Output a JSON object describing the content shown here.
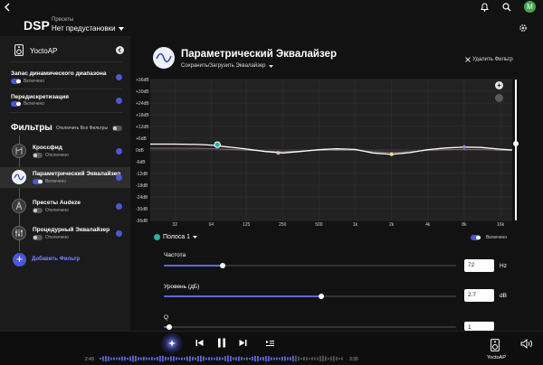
{
  "header": {
    "title": "DSP",
    "preset_caption": "Пресеты",
    "preset_value": "Нет предустановки",
    "avatar_letter": "M"
  },
  "sidebar": {
    "device_name": "YoctoAP",
    "settings": [
      {
        "label": "Запас динамического диапазона",
        "state": "Включено",
        "on": true
      },
      {
        "label": "Передискретизация",
        "state": "Включено",
        "on": true
      }
    ],
    "filters_title": "Фильтры",
    "disable_all_label": "Отключить Все Фильтры",
    "filters": [
      {
        "name": "Кроссфид",
        "state": "Отключено",
        "on": false,
        "selected": false
      },
      {
        "name": "Параметрический Эквалайзер",
        "state": "Включено",
        "on": true,
        "selected": true
      },
      {
        "name": "Пресеты Audeze",
        "state": "Отключено",
        "on": false,
        "selected": false
      },
      {
        "name": "Процедурный Эквалайзер",
        "state": "Отключено",
        "on": false,
        "selected": false
      }
    ],
    "add_filter_label": "Добавить Фильтр"
  },
  "main": {
    "title": "Параметрический Эквалайзер",
    "save_load_label": "Сохранить/Загрузить Эквалайзер",
    "delete_filter_label": "Удалить Фильтр"
  },
  "chart_data": {
    "type": "line",
    "x_scale": "log",
    "y_ticks": [
      "+36dB",
      "+30dB",
      "+24dB",
      "+18dB",
      "+12dB",
      "+6dB",
      "0dB",
      "-6dB",
      "-12dB",
      "-18dB",
      "-24dB",
      "-30dB",
      "-36dB"
    ],
    "x_ticks": [
      "32",
      "64",
      "125",
      "250",
      "500",
      "1k",
      "2k",
      "4k",
      "8k",
      "16k"
    ],
    "ylim": [
      -36,
      36
    ],
    "grid": true,
    "curve": {
      "x": [
        20,
        32,
        50,
        64,
        90,
        125,
        180,
        250,
        350,
        500,
        700,
        1000,
        1400,
        2000,
        2800,
        4000,
        5600,
        8000,
        11000,
        16000,
        20000
      ],
      "y": [
        3,
        3,
        2.8,
        2.5,
        1.5,
        0.5,
        -0.8,
        -1.5,
        -0.8,
        0.2,
        0.6,
        0.3,
        -1.5,
        -2.2,
        -1.4,
        0.2,
        1,
        1.5,
        1.3,
        0.4,
        0
      ]
    },
    "bands": [
      {
        "freq": 72,
        "gain": 2.7,
        "color": "#26b3a3"
      },
      {
        "freq": 230,
        "gain": -1.5,
        "color": "#e2b7d8"
      },
      {
        "freq": 2000,
        "gain": -2.2,
        "color": "#e7e86a"
      },
      {
        "freq": 8000,
        "gain": 1.5,
        "color": "#9a85d8"
      }
    ],
    "vertical_slider_value": 0
  },
  "band": {
    "label": "Полоса 1",
    "enabled_label": "Включено",
    "frequency": {
      "label": "Частота",
      "value": "72",
      "unit": "Hz",
      "level": 0.2
    },
    "gain": {
      "label": "Уровень (дБ)",
      "value": "2.7",
      "unit": "dB",
      "level": 0.54
    },
    "q": {
      "label": "Q",
      "value": "1",
      "level": 0.02
    }
  },
  "player": {
    "elapsed": "2:49",
    "total": "3:35",
    "progress": 0.79,
    "device_label": "YoctoAP"
  }
}
